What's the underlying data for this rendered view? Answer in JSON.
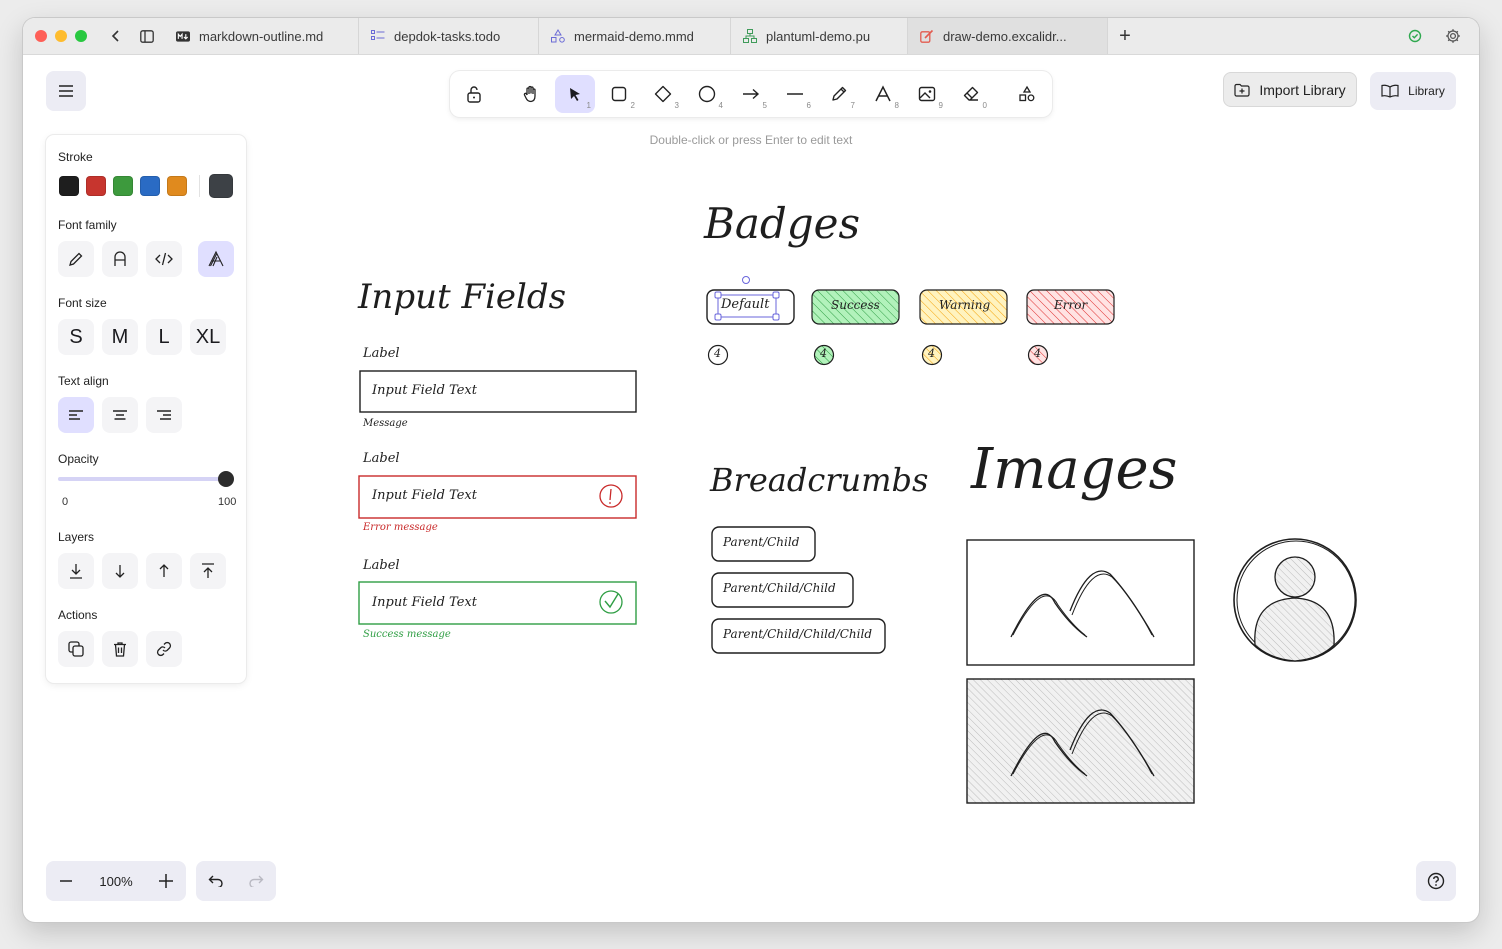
{
  "tabs": [
    {
      "label": "markdown-outline.md",
      "icon": "markdown-icon"
    },
    {
      "label": "depdok-tasks.todo",
      "icon": "todo-list-icon"
    },
    {
      "label": "mermaid-demo.mmd",
      "icon": "mermaid-icon"
    },
    {
      "label": "plantuml-demo.pu",
      "icon": "plantuml-icon"
    },
    {
      "label": "draw-demo.excalidr...",
      "icon": "excalidraw-icon",
      "active": true
    }
  ],
  "toolbar": {
    "tools": [
      {
        "name": "lock",
        "key": ""
      },
      {
        "name": "hand",
        "key": ""
      },
      {
        "name": "selection",
        "key": "1",
        "active": true
      },
      {
        "name": "rectangle",
        "key": "2"
      },
      {
        "name": "diamond",
        "key": "3"
      },
      {
        "name": "ellipse",
        "key": "4"
      },
      {
        "name": "arrow",
        "key": "5"
      },
      {
        "name": "line",
        "key": "6"
      },
      {
        "name": "draw",
        "key": "7"
      },
      {
        "name": "text",
        "key": "8"
      },
      {
        "name": "image",
        "key": "9"
      },
      {
        "name": "eraser",
        "key": "0"
      },
      {
        "name": "extra-tools",
        "key": ""
      }
    ],
    "hint": "Double-click or press Enter to edit text"
  },
  "header_buttons": {
    "import_library": "Import Library",
    "library": "Library"
  },
  "properties": {
    "stroke_label": "Stroke",
    "stroke_colors": [
      "#1e1e1e",
      "#e03131",
      "#2f9e44",
      "#1971c2",
      "#f08c00"
    ],
    "stroke_current": "#343a40",
    "font_family_label": "Font family",
    "font_size_label": "Font size",
    "font_sizes": [
      "S",
      "M",
      "L",
      "XL"
    ],
    "text_align_label": "Text align",
    "opacity_label": "Opacity",
    "opacity_min": "0",
    "opacity_max": "100",
    "opacity_value": 100,
    "layers_label": "Layers",
    "actions_label": "Actions"
  },
  "zoom": {
    "value": "100%"
  },
  "canvas": {
    "input_fields": {
      "title": "Input Fields",
      "fields": [
        {
          "label": "Label",
          "text": "Input Field Text",
          "message": "Message",
          "state": "default"
        },
        {
          "label": "Label",
          "text": "Input Field Text",
          "message": "Error message",
          "state": "error"
        },
        {
          "label": "Label",
          "text": "Input Field Text",
          "message": "Success message",
          "state": "success"
        }
      ]
    },
    "badges": {
      "title": "Badges",
      "items": [
        {
          "label": "Default",
          "count": "4",
          "color": "#ffffff"
        },
        {
          "label": "Success",
          "count": "4",
          "color": "#b2f2bb"
        },
        {
          "label": "Warning",
          "count": "4",
          "color": "#ffec99"
        },
        {
          "label": "Error",
          "count": "4",
          "color": "#ffc9c9"
        }
      ]
    },
    "breadcrumbs": {
      "title": "Breadcrumbs",
      "items": [
        "Parent/Child",
        "Parent/Child/Child",
        "Parent/Child/Child/Child"
      ]
    },
    "images": {
      "title": "Images"
    }
  },
  "colors": {
    "accent": "#6965db",
    "accent_light": "#e0dfff",
    "error": "#c92a2a",
    "success": "#2f9e44"
  }
}
